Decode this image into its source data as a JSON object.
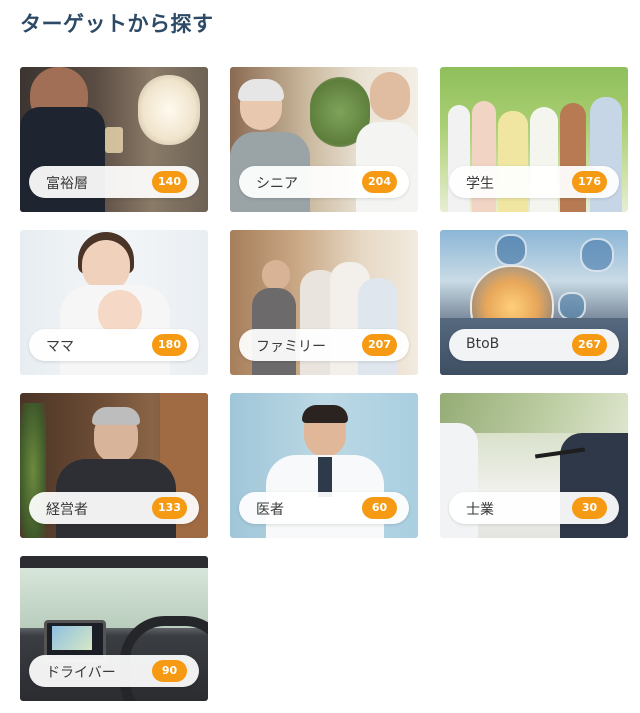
{
  "section_title": "ターゲットから探す",
  "targets": [
    {
      "label": "富裕層",
      "count": "140"
    },
    {
      "label": "シニア",
      "count": "204"
    },
    {
      "label": "学生",
      "count": "176"
    },
    {
      "label": "ママ",
      "count": "180"
    },
    {
      "label": "ファミリー",
      "count": "207"
    },
    {
      "label": "BtoB",
      "count": "267"
    },
    {
      "label": "経営者",
      "count": "133"
    },
    {
      "label": "医者",
      "count": "60"
    },
    {
      "label": "士業",
      "count": "30"
    },
    {
      "label": "ドライバー",
      "count": "90"
    }
  ],
  "colors": {
    "title": "#2c4a66",
    "badge": "#f59a12",
    "pill": "#ffffff"
  }
}
